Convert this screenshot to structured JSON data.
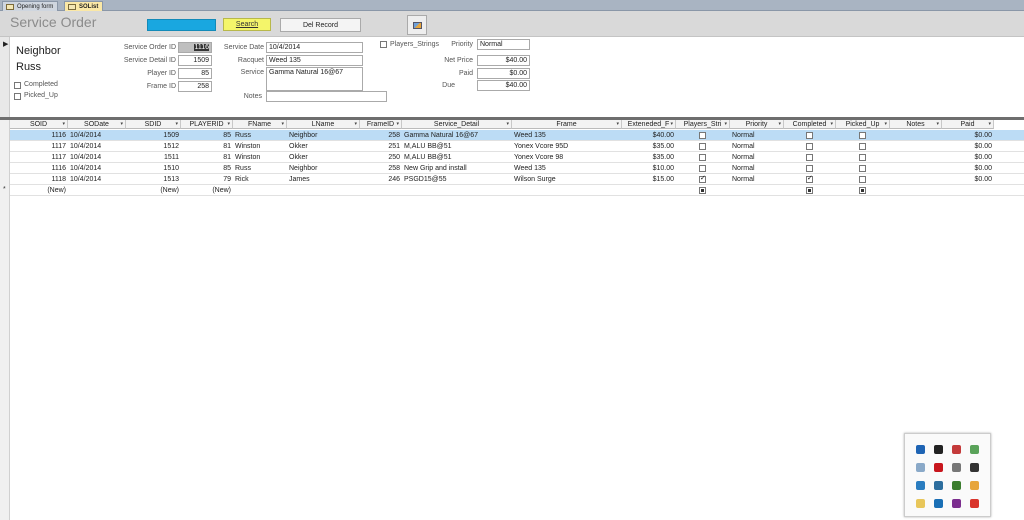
{
  "tabs": [
    {
      "label": "Opening form"
    },
    {
      "label": "SOList"
    }
  ],
  "header": {
    "title": "Service Order",
    "search_label": "Search",
    "del_record_label": "Del Record"
  },
  "form": {
    "record_selector": "▶",
    "first_name": "Neighbor",
    "last_name": "Russ",
    "completed_label": "Completed",
    "completed": false,
    "picked_up_label": "Picked_Up",
    "picked_up": false,
    "service_order_id_label": "Service Order ID",
    "service_order_id": "1116",
    "service_detail_id_label": "Service Detail ID",
    "service_detail_id": "1509",
    "player_id_label": "Player ID",
    "player_id": "85",
    "frame_id_label": "Frame ID",
    "frame_id": "258",
    "service_date_label": "Service Date",
    "service_date": "10/4/2014",
    "racquet_label": "Racquet",
    "racquet": "Weed 135",
    "service_label": "Service",
    "service": "Gamma Natural 16@67",
    "notes_label": "Notes",
    "notes": "",
    "players_strings_label": "Players_Strings",
    "players_strings": false,
    "priority_label": "Priority",
    "priority": "Normal",
    "net_price_label": "Net Price",
    "net_price": "$40.00",
    "paid_label": "Paid",
    "paid": "$0.00",
    "due_label": "Due",
    "due": "$40.00"
  },
  "grid": {
    "columns": [
      "SOID",
      "SODate",
      "SDID",
      "PLAYERID",
      "FName",
      "LName",
      "FrameID",
      "Service_Detail",
      "Frame",
      "Exteneded_F",
      "Players_Stri",
      "Priority",
      "Completed",
      "Picked_Up",
      "Notes",
      "Paid"
    ],
    "rows": [
      {
        "soid": "1116",
        "sodate": "10/4/2014",
        "sdid": "1509",
        "playerid": "85",
        "fname": "Russ",
        "lname": "Neighbor",
        "frameid": "258",
        "service_detail": "Gamma Natural 16@67",
        "frame": "Weed 135",
        "ext": "$40.00",
        "players": false,
        "priority": "Normal",
        "completed": false,
        "picked": false,
        "notes": "",
        "paid": "$0.00"
      },
      {
        "soid": "1117",
        "sodate": "10/4/2014",
        "sdid": "1512",
        "playerid": "81",
        "fname": "Winston",
        "lname": "Okker",
        "frameid": "251",
        "service_detail": "M,ALU BB@51",
        "frame": "Yonex Vcore 95D",
        "ext": "$35.00",
        "players": false,
        "priority": "Normal",
        "completed": false,
        "picked": false,
        "notes": "",
        "paid": "$0.00"
      },
      {
        "soid": "1117",
        "sodate": "10/4/2014",
        "sdid": "1511",
        "playerid": "81",
        "fname": "Winston",
        "lname": "Okker",
        "frameid": "250",
        "service_detail": "M,ALU BB@51",
        "frame": "Yonex Vcore 98",
        "ext": "$35.00",
        "players": false,
        "priority": "Normal",
        "completed": false,
        "picked": false,
        "notes": "",
        "paid": "$0.00"
      },
      {
        "soid": "1116",
        "sodate": "10/4/2014",
        "sdid": "1510",
        "playerid": "85",
        "fname": "Russ",
        "lname": "Neighbor",
        "frameid": "258",
        "service_detail": "New Grip and install",
        "frame": "Weed 135",
        "ext": "$10.00",
        "players": false,
        "priority": "Normal",
        "completed": false,
        "picked": false,
        "notes": "",
        "paid": "$0.00"
      },
      {
        "soid": "1118",
        "sodate": "10/4/2014",
        "sdid": "1513",
        "playerid": "79",
        "fname": "Rick",
        "lname": "James",
        "frameid": "246",
        "service_detail": "PSGD15@55",
        "frame": "Wilson Surge",
        "ext": "$15.00",
        "players": true,
        "priority": "Normal",
        "completed": true,
        "picked": false,
        "notes": "",
        "paid": "$0.00"
      }
    ],
    "new_row": {
      "soid": "(New)",
      "sdid": "(New)",
      "playerid": "(New)"
    }
  },
  "tray_icons": [
    "bluetooth-icon",
    "app-icon",
    "shield-icon",
    "network-icon",
    "cloud-icon",
    "mcafee-icon",
    "usb-icon",
    "qr-icon",
    "monitor-icon",
    "display-icon",
    "gpu-icon",
    "office-icon",
    "folder-icon",
    "exchange-icon",
    "onenote-icon",
    "pdf-icon"
  ]
}
